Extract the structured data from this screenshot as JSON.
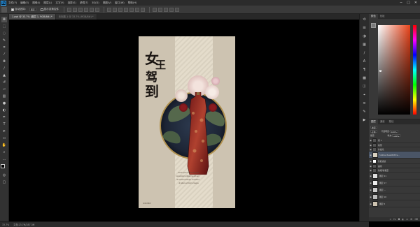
{
  "app": {
    "logo": "Ps",
    "menus": [
      "文件(F)",
      "编辑(E)",
      "图像(I)",
      "图层(L)",
      "文字(Y)",
      "选择(S)",
      "滤镜(T)",
      "3D(D)",
      "视图(V)",
      "窗口(W)",
      "帮助(H)"
    ],
    "window_controls": [
      "−",
      "□",
      "✕"
    ]
  },
  "options": {
    "auto_select_label": "自动选择：",
    "auto_select_target": "图层",
    "show_transform_label": "显示变换控件"
  },
  "tabs": [
    {
      "label": "1.psd @ 33.7% (图层 1, RGB/8#) *",
      "active": true
    },
    {
      "label": "未标题-1 @ 33.7% (RGB/8#) *",
      "active": false
    }
  ],
  "tools": [
    "move-tool",
    "marquee-tool",
    "lasso-tool",
    "quick-select-tool",
    "crop-tool",
    "eyedropper-tool",
    "healing-tool",
    "brush-tool",
    "stamp-tool",
    "history-brush-tool",
    "eraser-tool",
    "gradient-tool",
    "blur-tool",
    "dodge-tool",
    "pen-tool",
    "type-tool",
    "path-select-tool",
    "shape-tool",
    "hand-tool",
    "zoom-tool"
  ],
  "poster": {
    "title_chars": [
      "女",
      "王",
      "驾",
      "到"
    ],
    "footer_line1": "Lorem ipsum dolor sit amet",
    "footer_line2": "consectetur adipiscing elit sed",
    "footer_line3": "do eiusmod tempor incididunt",
    "footer_line4": "ut labore et dolore magna",
    "corner_text": "2018.NEW"
  },
  "colors": {
    "brand": "#31a8ff",
    "picker_hue": "#e8431a",
    "layer_selected": "#4a5566",
    "poster_bg": "#cdc3b1"
  },
  "color_panel": {
    "tabs": [
      "颜色",
      "色板"
    ]
  },
  "layers_panel": {
    "tabs": [
      "图层",
      "通道",
      "路径"
    ],
    "kind_filter": "类型",
    "blend_mode": "正常",
    "opacity_label": "不透明度:",
    "opacity_value": "100%",
    "lock_label": "锁定:",
    "fill_label": "填充:",
    "fill_value": "100%",
    "layers": [
      {
        "name": "组 1",
        "thumb": "#555555",
        "selected": false
      },
      {
        "name": "效果",
        "thumb": "#555555",
        "selected": false
      },
      {
        "name": "外发光",
        "thumb": "#555555",
        "selected": false
      },
      {
        "name": "5b26ac3ea48d87a...",
        "thumb": "#d8d0c0",
        "selected": true
      },
      {
        "name": "智能滤镜",
        "thumb": "#ffffff",
        "selected": false
      },
      {
        "name": "曲线",
        "thumb": "#555555",
        "selected": false
      },
      {
        "name": "色相/饱和度",
        "thumb": "#555555",
        "selected": false
      },
      {
        "name": "图层 21",
        "thumb": "#dddddd",
        "selected": false
      },
      {
        "name": "图层 17",
        "thumb": "#eeeeee",
        "selected": false
      },
      {
        "name": "图层 ...",
        "thumb": "#cccccc",
        "selected": false
      },
      {
        "name": "图层 16",
        "thumb": "#bbbbbb",
        "selected": false
      },
      {
        "name": "图层 5",
        "thumb": "#cdc3b1",
        "selected": false
      }
    ],
    "footer_icons": [
      "link-icon",
      "fx-icon",
      "mask-icon",
      "adjustment-icon",
      "folder-icon",
      "new-layer-icon",
      "trash-icon"
    ]
  },
  "status": {
    "zoom": "33.7%",
    "doc_size": "文档:23.7M/287.3M"
  }
}
